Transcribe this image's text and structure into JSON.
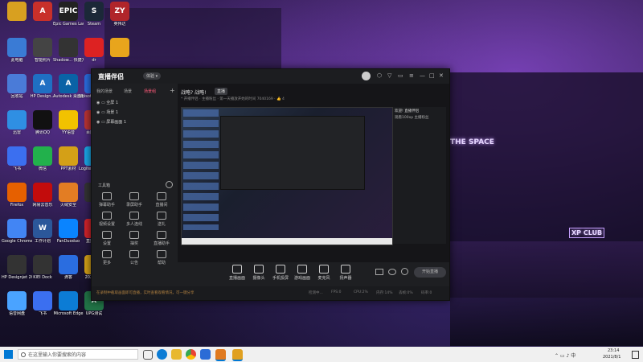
{
  "desktop": {
    "icons": [
      {
        "label": "",
        "color": "#d8a020",
        "glyph": ""
      },
      {
        "label": "",
        "color": "#c8302a",
        "glyph": "A"
      },
      {
        "label": "Epic Games Launcher",
        "color": "#222",
        "glyph": "EPIC"
      },
      {
        "label": "Steam",
        "color": "#1b2838",
        "glyph": "S"
      },
      {
        "label": "英伟达",
        "color": "#b0252a",
        "glyph": "ZY"
      },
      {
        "label": "此电脑",
        "color": "#3a7bd5",
        "glyph": ""
      },
      {
        "label": "智能照片",
        "color": "#444",
        "glyph": ""
      },
      {
        "label": "Shadow... 快捷方式",
        "color": "#333",
        "glyph": ""
      },
      {
        "label": "dr",
        "color": "#d22",
        "glyph": ""
      },
      {
        "label": "",
        "color": "#e8a51c",
        "glyph": ""
      },
      {
        "label": "一键卸载",
        "color": "#2b6cd6",
        "glyph": ""
      },
      {
        "label": "回收站",
        "color": "#4a7bd8",
        "glyph": ""
      },
      {
        "label": "HP Design...",
        "color": "#1f6fc3",
        "glyph": "A"
      },
      {
        "label": "Autodesk 桌面应用程序",
        "color": "#0a62a6",
        "glyph": "A"
      },
      {
        "label": "Ubisoft Connect",
        "color": "#2a6de0",
        "glyph": "U"
      },
      {
        "label": "Microsoft Word",
        "color": "#2b579a",
        "glyph": "W"
      },
      {
        "label": "迅雷",
        "color": "#2f8fe3",
        "glyph": ""
      },
      {
        "label": "腾讯QQ",
        "color": "#111",
        "glyph": ""
      },
      {
        "label": "YY语音",
        "color": "#f2c200",
        "glyph": ""
      },
      {
        "label": "百度网盘",
        "color": "#b33",
        "glyph": ""
      },
      {
        "label": "飞书",
        "color": "#3b6ff0",
        "glyph": ""
      },
      {
        "label": "微信",
        "color": "#22b14c",
        "glyph": ""
      },
      {
        "label": "PPT素材",
        "color": "#d4a017",
        "glyph": ""
      },
      {
        "label": "Logitech G HUB",
        "color": "#1aa8e8",
        "glyph": "G"
      },
      {
        "label": "Firefox",
        "color": "#e66000",
        "glyph": ""
      },
      {
        "label": "网易云音乐",
        "color": "#c20c0c",
        "glyph": ""
      },
      {
        "label": "火绒安全",
        "color": "#e37d23",
        "glyph": ""
      },
      {
        "label": "",
        "color": "#333",
        "glyph": ""
      },
      {
        "label": "Google Chrome",
        "color": "#4285f4",
        "glyph": ""
      },
      {
        "label": "工作计划",
        "color": "#2b579a",
        "glyph": "W"
      },
      {
        "label": "FanDuoduo",
        "color": "#0a84ff",
        "glyph": ""
      },
      {
        "label": "直播伴侣",
        "color": "#d2232a",
        "glyph": ""
      },
      {
        "label": "HP Designjet 2050",
        "color": "#333",
        "glyph": ""
      },
      {
        "label": "KIEI Dock",
        "color": "#333",
        "glyph": ""
      },
      {
        "label": "滴答",
        "color": "#2a6de0",
        "glyph": ""
      },
      {
        "label": "2020工作",
        "color": "#d4a017",
        "glyph": ""
      },
      {
        "label": "语音网盘",
        "color": "#4aa3ff",
        "glyph": ""
      },
      {
        "label": "飞书",
        "color": "#3b6ff0",
        "glyph": ""
      },
      {
        "label": "Microsoft Edge",
        "color": "#0c7cd5",
        "glyph": ""
      },
      {
        "label": "UPG测试",
        "color": "#217346",
        "glyph": "X"
      }
    ]
  },
  "wallpaper": {
    "signs": [
      "THE SPACE",
      "XP CLUB"
    ]
  },
  "app": {
    "logo": "直播伴侣",
    "version_pill": "体验 ▾",
    "left_tabs": [
      "我的场景",
      "场景",
      "场景组"
    ],
    "scene_add": "+",
    "scenes": [
      "全屏 1",
      "场景 1",
      "屏幕画面 1"
    ],
    "tools_header": "工具箱",
    "tools": [
      {
        "label": "弹幕助手"
      },
      {
        "label": "录屏助手"
      },
      {
        "label": "直播间"
      },
      {
        "label": "视频设置"
      },
      {
        "label": "多人连线"
      },
      {
        "label": "送礼"
      },
      {
        "label": "设置"
      },
      {
        "label": "抽奖"
      },
      {
        "label": "直播助手"
      },
      {
        "label": "更多"
      },
      {
        "label": "公告"
      },
      {
        "label": "帮助"
      }
    ],
    "tip_text": "在录制中截取画面即可直播，实时查看观看情况，可一键分享",
    "room_title": "战略? 战略!",
    "room_status": "直播",
    "room_sub": "* 开播伴侣 · 主播粉丝 · 第一天播放开始的时间 7040169 · 👍 4",
    "chat_title": "欢迎! 直播伴侣",
    "chat_sub": "观看100xp 主播粉丝",
    "toolbar": [
      {
        "label": "直播画面"
      },
      {
        "label": "摄像头"
      },
      {
        "label": "手机投屏"
      },
      {
        "label": "游戏画面"
      },
      {
        "label": "麦克风"
      },
      {
        "label": "扬声器"
      }
    ],
    "start_button": "开始直播",
    "status_items": [
      "检测中...",
      "FPS:0",
      "CPU:2%",
      "内存:14%",
      "丢帧:0%",
      "码率:0"
    ]
  },
  "taskbar": {
    "search_placeholder": "在这里输入你要搜索的内容",
    "time": "23:14",
    "date": "2021/8/1"
  }
}
